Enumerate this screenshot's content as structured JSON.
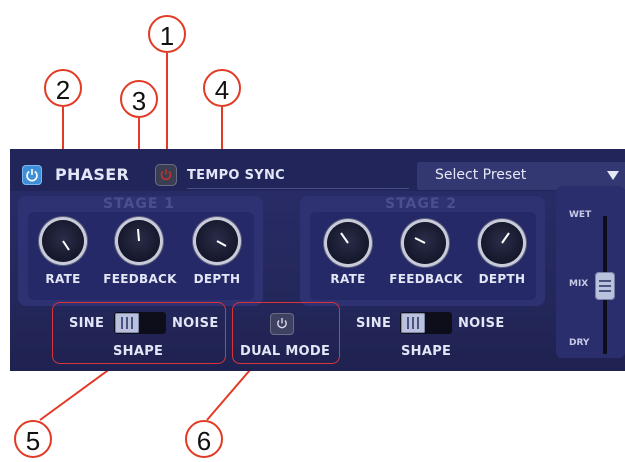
{
  "callouts": [
    "1",
    "2",
    "3",
    "4",
    "5",
    "6"
  ],
  "header": {
    "title": "PHASER",
    "tempo_sync_label": "TEMPO SYNC",
    "preset_label": "Select Preset"
  },
  "stages": [
    {
      "title": "STAGE 1",
      "knobs": [
        {
          "label": "RATE"
        },
        {
          "label": "FEEDBACK"
        },
        {
          "label": "DEPTH"
        }
      ],
      "shape": {
        "left": "SINE",
        "right": "NOISE",
        "label": "SHAPE",
        "selected": "SINE"
      }
    },
    {
      "title": "STAGE 2",
      "knobs": [
        {
          "label": "RATE"
        },
        {
          "label": "FEEDBACK"
        },
        {
          "label": "DEPTH"
        }
      ],
      "shape": {
        "left": "SINE",
        "right": "NOISE",
        "label": "SHAPE",
        "selected": "SINE"
      }
    }
  ],
  "dual_mode_label": "DUAL MODE",
  "mix": {
    "wet": "WET",
    "mix": "MIX",
    "dry": "DRY"
  },
  "colors": {
    "callout": "#e23a25",
    "panel": "#25285c",
    "accent": "#3f8fd8"
  }
}
